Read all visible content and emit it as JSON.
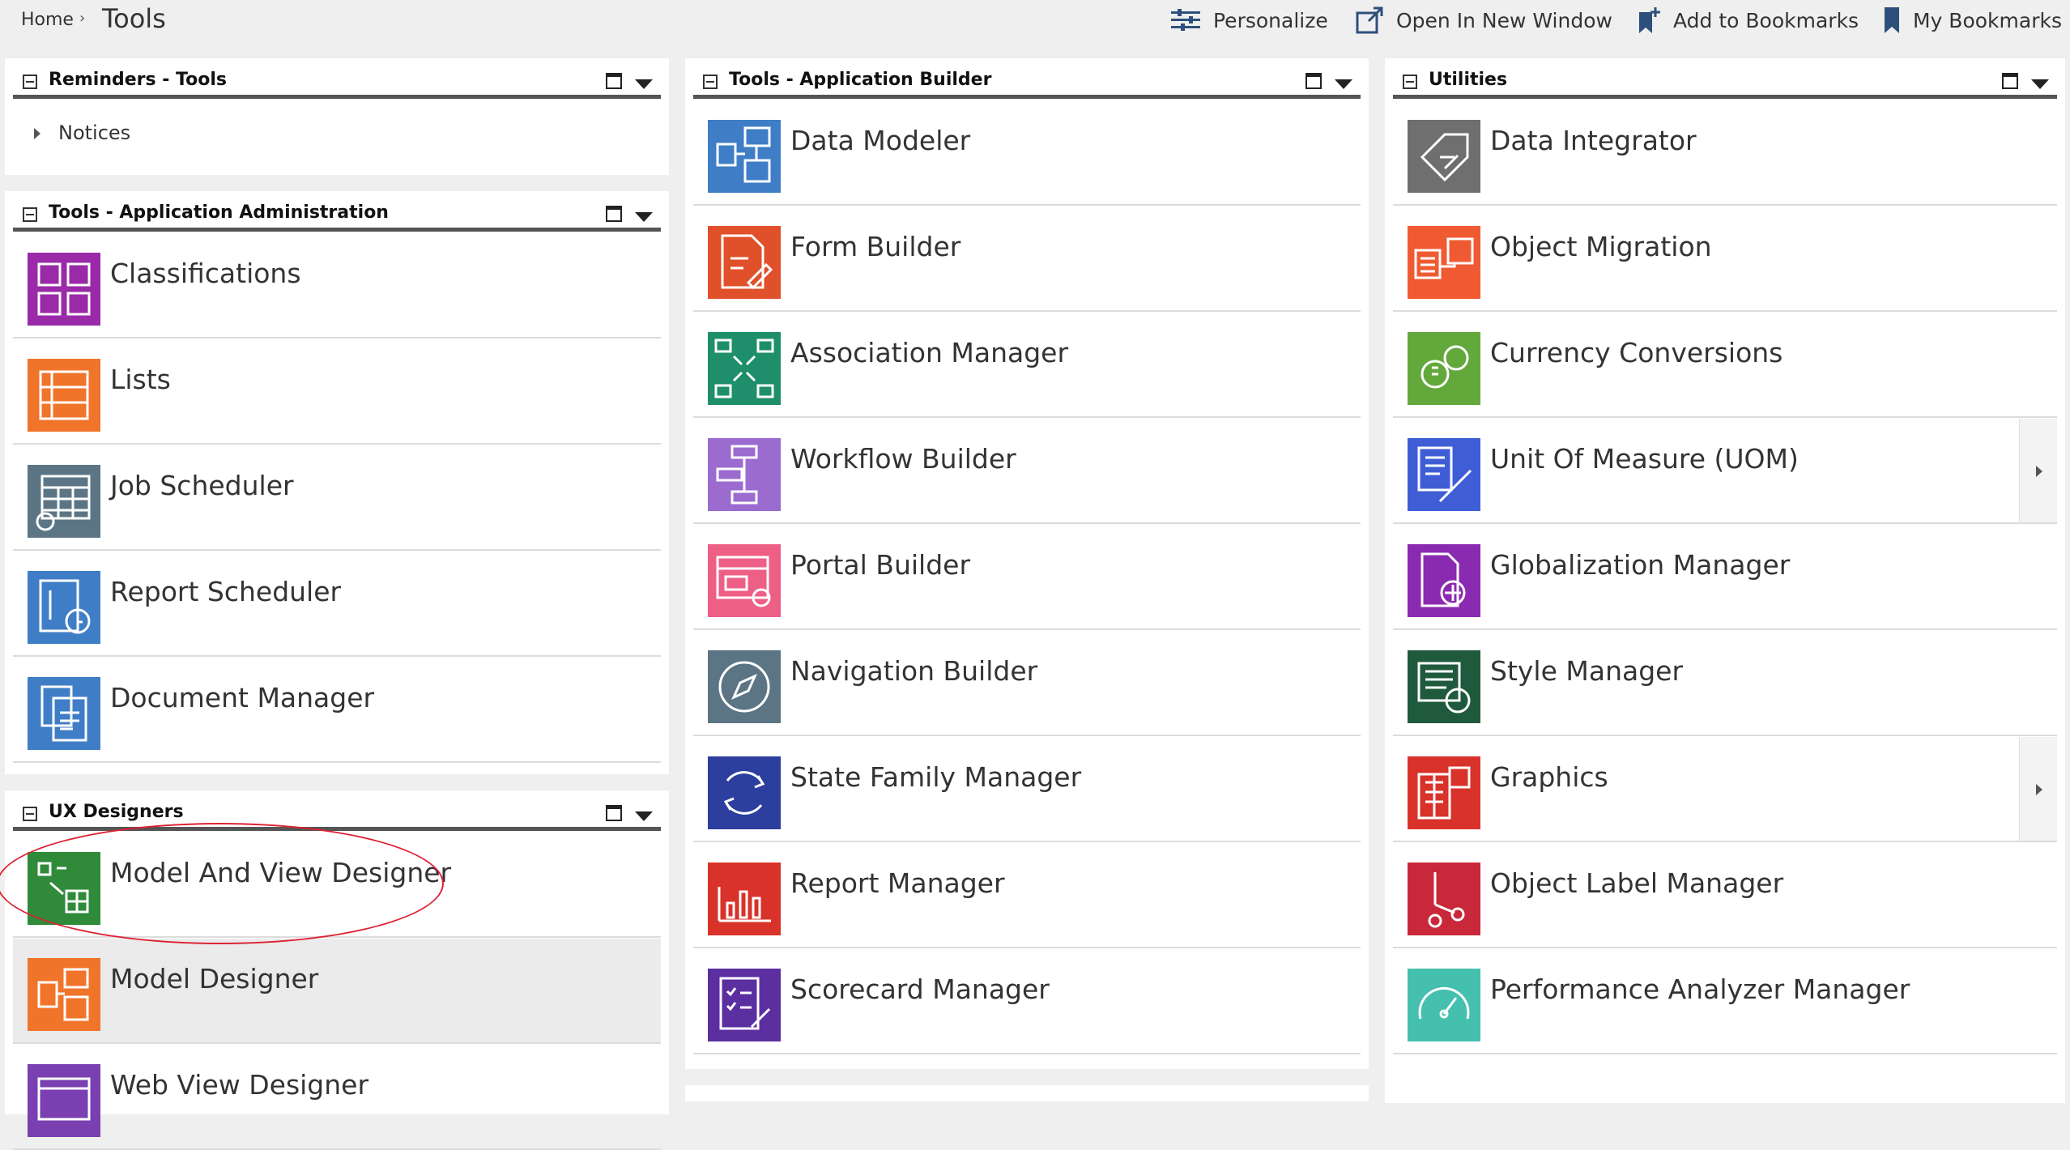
{
  "breadcrumb": {
    "home": "Home",
    "separator": "›",
    "current": "Tools"
  },
  "toolbar": {
    "personalize": "Personalize",
    "open_new_window": "Open In New Window",
    "add_bookmarks": "Add to Bookmarks",
    "my_bookmarks": "My Bookmarks"
  },
  "col1": {
    "reminders": {
      "title": "Reminders - Tools",
      "notices": "Notices"
    },
    "app_admin": {
      "title": "Tools - Application Administration",
      "items": [
        {
          "label": "Classifications",
          "color": "#9a2aa8",
          "icon": "classifications-icon"
        },
        {
          "label": "Lists",
          "color": "#f0742a",
          "icon": "lists-icon"
        },
        {
          "label": "Job Scheduler",
          "color": "#5c7585",
          "icon": "job-scheduler-icon"
        },
        {
          "label": "Report Scheduler",
          "color": "#3f7ec6",
          "icon": "report-scheduler-icon"
        },
        {
          "label": "Document Manager",
          "color": "#3f7ec6",
          "icon": "document-manager-icon"
        }
      ]
    },
    "ux": {
      "title": "UX Designers",
      "items": [
        {
          "label": "Model And View Designer",
          "color": "#2f8a3a",
          "icon": "model-view-designer-icon"
        },
        {
          "label": "Model Designer",
          "color": "#f0742a",
          "icon": "model-designer-icon"
        },
        {
          "label": "Web View Designer",
          "color": "#7a3fb0",
          "icon": "web-view-designer-icon"
        }
      ]
    }
  },
  "col2": {
    "title": "Tools - Application Builder",
    "items": [
      {
        "label": "Data Modeler",
        "color": "#3f7ec6",
        "icon": "data-modeler-icon"
      },
      {
        "label": "Form Builder",
        "color": "#e0502a",
        "icon": "form-builder-icon"
      },
      {
        "label": "Association Manager",
        "color": "#1e8f6a",
        "icon": "association-manager-icon"
      },
      {
        "label": "Workflow Builder",
        "color": "#9b6bd0",
        "icon": "workflow-builder-icon"
      },
      {
        "label": "Portal Builder",
        "color": "#ee5f86",
        "icon": "portal-builder-icon"
      },
      {
        "label": "Navigation Builder",
        "color": "#5c7585",
        "icon": "navigation-builder-icon"
      },
      {
        "label": "State Family Manager",
        "color": "#2c3f9e",
        "icon": "state-family-manager-icon"
      },
      {
        "label": "Report Manager",
        "color": "#d8322a",
        "icon": "report-manager-icon"
      },
      {
        "label": "Scorecard Manager",
        "color": "#5c2fa0",
        "icon": "scorecard-manager-icon"
      }
    ]
  },
  "col3": {
    "title": "Utilities",
    "items": [
      {
        "label": "Data Integrator",
        "color": "#6f6f6f",
        "icon": "data-integrator-icon"
      },
      {
        "label": "Object Migration",
        "color": "#f05a32",
        "icon": "object-migration-icon"
      },
      {
        "label": "Currency Conversions",
        "color": "#63a83a",
        "icon": "currency-conversions-icon"
      },
      {
        "label": "Unit Of Measure (UOM)",
        "color": "#3f5ed6",
        "icon": "unit-of-measure-icon"
      },
      {
        "label": "Globalization Manager",
        "color": "#8a2ab0",
        "icon": "globalization-manager-icon"
      },
      {
        "label": "Style Manager",
        "color": "#1f5a3c",
        "icon": "style-manager-icon"
      },
      {
        "label": "Graphics",
        "color": "#d8322a",
        "icon": "graphics-icon"
      },
      {
        "label": "Object Label Manager",
        "color": "#c8283a",
        "icon": "object-label-manager-icon"
      },
      {
        "label": "Performance Analyzer Manager",
        "color": "#45bfae",
        "icon": "performance-analyzer-icon"
      }
    ]
  }
}
